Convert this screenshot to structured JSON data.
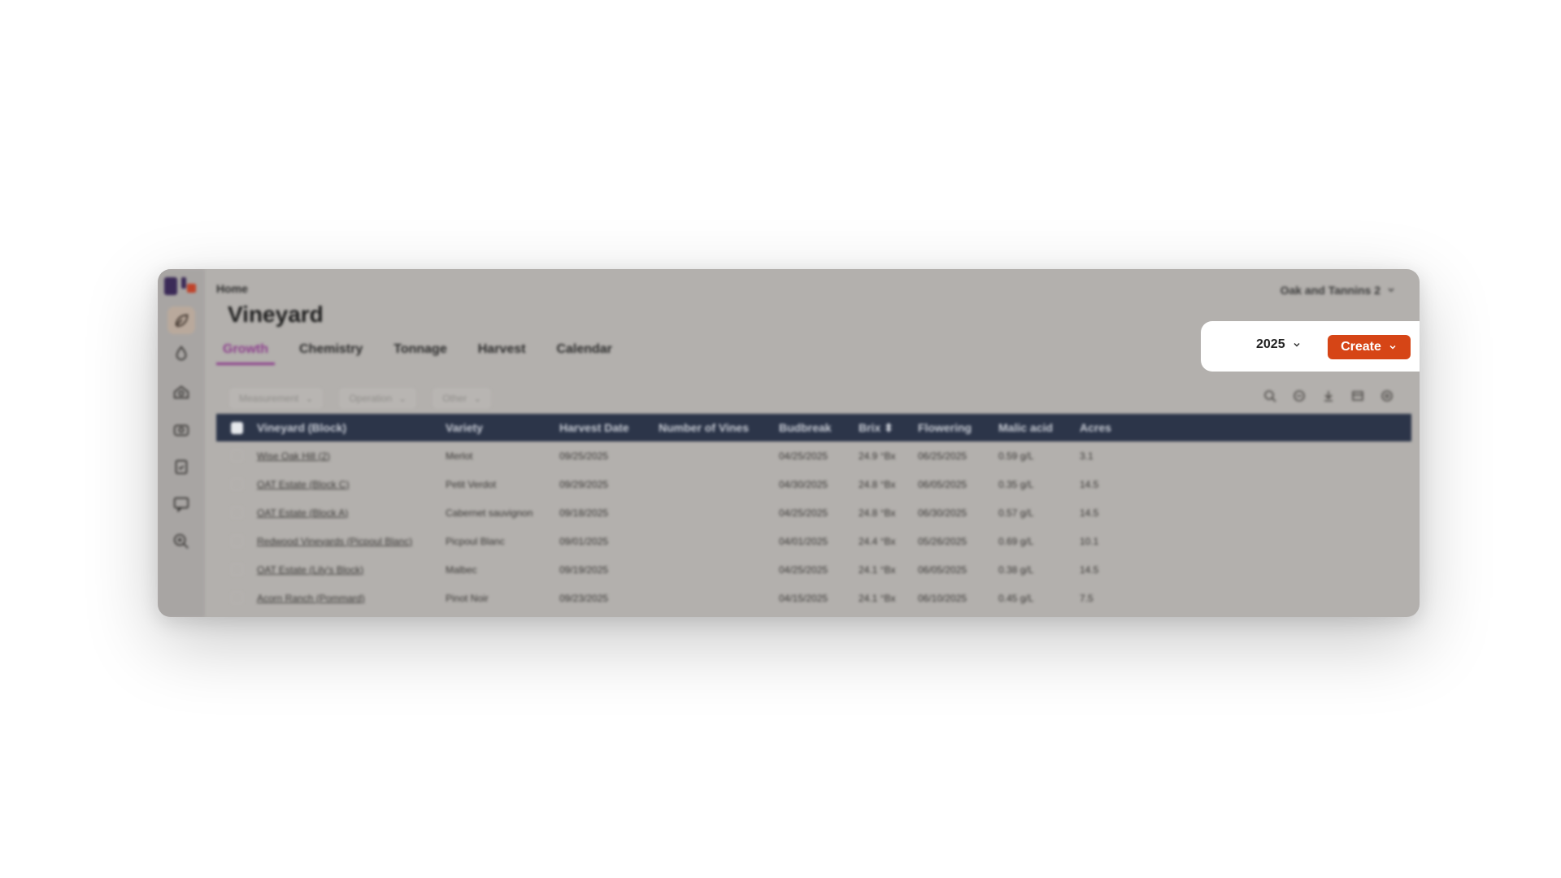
{
  "app": {
    "breadcrumb": "Home",
    "title": "Vineyard",
    "org": "Oak and Tannins 2"
  },
  "tabs": [
    {
      "label": "Growth",
      "active": true
    },
    {
      "label": "Chemistry"
    },
    {
      "label": "Tonnage"
    },
    {
      "label": "Harvest"
    },
    {
      "label": "Calendar"
    }
  ],
  "filters": [
    {
      "label": "Measurement"
    },
    {
      "label": "Operation"
    },
    {
      "label": "Other"
    }
  ],
  "toolbar": {
    "year": "2025",
    "create_label": "Create"
  },
  "table": {
    "columns": [
      "Vineyard (Block)",
      "Variety",
      "Harvest Date",
      "Number of Vines",
      "Budbreak",
      "Brix",
      "Flowering",
      "Malic acid",
      "Acres"
    ],
    "rows": [
      {
        "vineyard": "Wise Oak Hill (2)",
        "variety": "Merlot",
        "harvest": "09/25/2025",
        "vines": "",
        "budbreak": "04/25/2025",
        "brix": "24.9 °Bx",
        "flowering": "06/25/2025",
        "malic": "0.59 g/L",
        "acres": "3.1"
      },
      {
        "vineyard": "OAT Estate (Block C)",
        "variety": "Petit Verdot",
        "harvest": "09/29/2025",
        "vines": "",
        "budbreak": "04/30/2025",
        "brix": "24.8 °Bx",
        "flowering": "06/05/2025",
        "malic": "0.35 g/L",
        "acres": "14.5"
      },
      {
        "vineyard": "OAT Estate (Block A)",
        "variety": "Cabernet sauvignon",
        "harvest": "09/18/2025",
        "vines": "",
        "budbreak": "04/25/2025",
        "brix": "24.8 °Bx",
        "flowering": "06/30/2025",
        "malic": "0.57 g/L",
        "acres": "14.5"
      },
      {
        "vineyard": "Redwood Vineyards (Picpoul Blanc)",
        "variety": "Picpoul Blanc",
        "harvest": "09/01/2025",
        "vines": "",
        "budbreak": "04/01/2025",
        "brix": "24.4 °Bx",
        "flowering": "05/26/2025",
        "malic": "0.69 g/L",
        "acres": "10.1"
      },
      {
        "vineyard": "OAT Estate (Lily's Block)",
        "variety": "Malbec",
        "harvest": "09/19/2025",
        "vines": "",
        "budbreak": "04/25/2025",
        "brix": "24.1 °Bx",
        "flowering": "06/05/2025",
        "malic": "0.38 g/L",
        "acres": "14.5"
      },
      {
        "vineyard": "Acorn Ranch (Pommard)",
        "variety": "Pinot Noir",
        "harvest": "09/23/2025",
        "vines": "",
        "budbreak": "04/15/2025",
        "brix": "24.1 °Bx",
        "flowering": "06/10/2025",
        "malic": "0.45 g/L",
        "acres": "7.5"
      }
    ]
  },
  "icons": [
    "leaf-icon",
    "drop-icon",
    "barrel-icon",
    "camera-icon",
    "clipboard-icon",
    "chat-icon",
    "search-plus-icon",
    "search-icon",
    "print-icon",
    "download-icon",
    "columns-icon",
    "settings-icon"
  ],
  "colors": {
    "accent": "#8c3e8c",
    "create": "#d64516",
    "table_header": "#2c3549"
  }
}
